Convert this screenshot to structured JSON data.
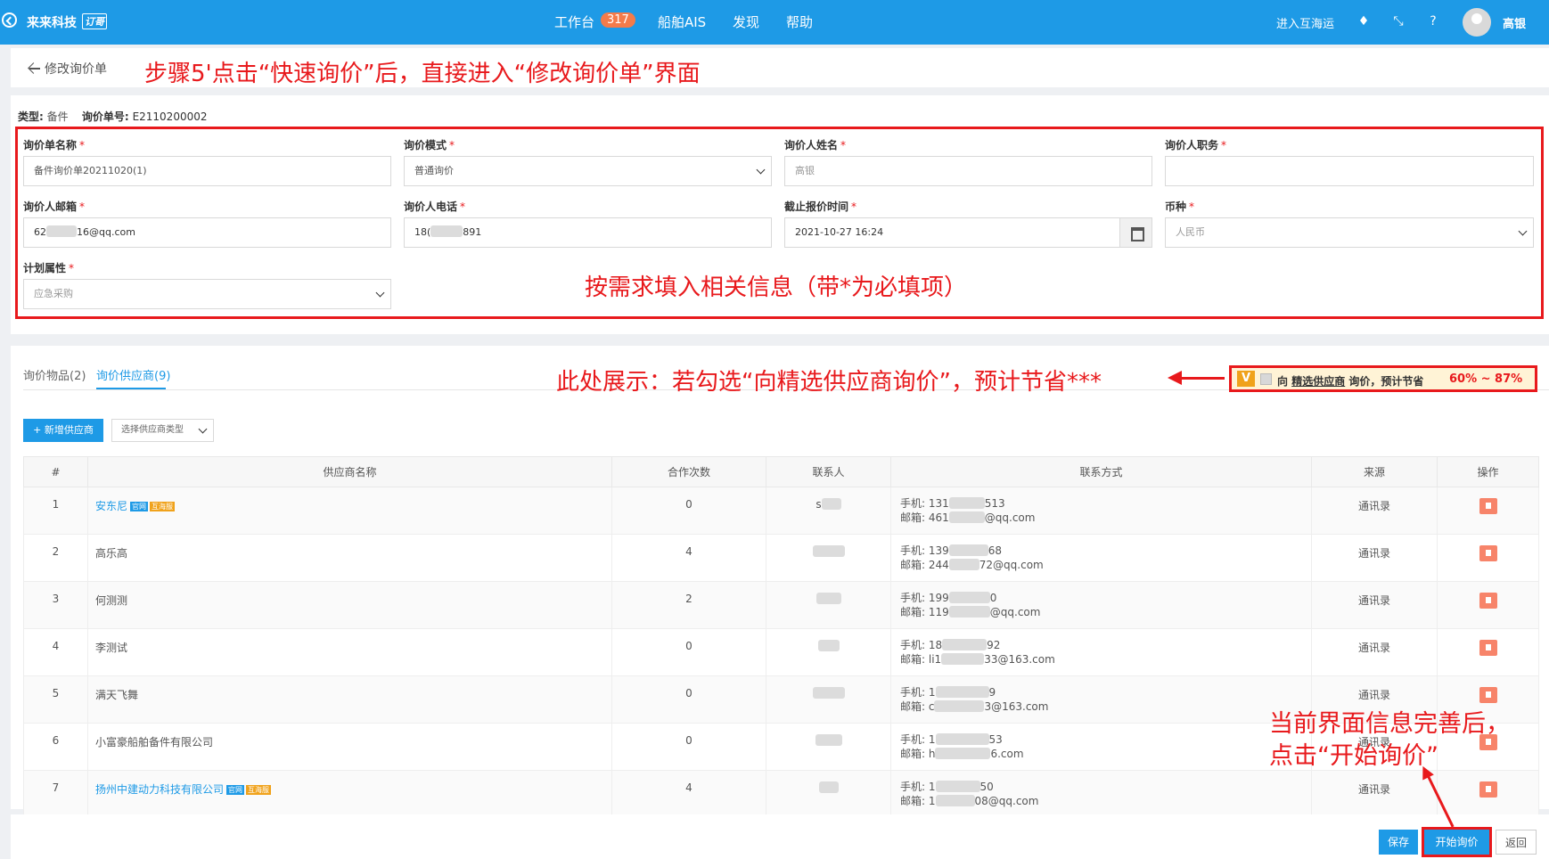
{
  "topbar": {
    "brand": "来来科技",
    "brand_badge": "订哥",
    "nav": [
      {
        "label": "工作台"
      },
      {
        "label": "船舶AIS"
      },
      {
        "label": "发现"
      },
      {
        "label": "帮助"
      }
    ],
    "workbench_count": "317",
    "enter_link": "进入互海运",
    "user_name": "高银",
    "colors": {
      "primary": "#1e9ae6",
      "badge": "#f37b4a",
      "annotation": "#e8191c"
    }
  },
  "header": {
    "back_label": "修改询价单",
    "annotation": "步骤5'点击“快速询价”后，直接进入“修改询价单”界面"
  },
  "meta": {
    "type_label": "类型:",
    "type_value": "备件",
    "no_label": "询价单号:",
    "no_value": "E2110200002"
  },
  "form": {
    "fields": [
      {
        "label": "询价单名称",
        "value": "备件询价单20211020(1)"
      },
      {
        "label": "询价模式",
        "value": "普通询价"
      },
      {
        "label": "询价人姓名",
        "value": "高银"
      },
      {
        "label": "询价人职务",
        "value": ""
      },
      {
        "label": "询价人邮箱",
        "value_prefix": "62",
        "value_suffix": "16@qq.com"
      },
      {
        "label": "询价人电话",
        "value_prefix": "18(",
        "value_suffix": "891"
      },
      {
        "label": "截止报价时间",
        "value": "2021-10-27 16:24"
      },
      {
        "label": "币种",
        "value": "人民币"
      },
      {
        "label": "计划属性",
        "value": "应急采购"
      }
    ],
    "required_mark": "*",
    "annotation": "按需求填入相关信息（带*为必填项）"
  },
  "tabs": [
    {
      "label": "询价物品(2)"
    },
    {
      "label": "询价供应商(9)"
    }
  ],
  "promo": {
    "annotation": "此处展示：若勾选“向精选供应商询价”，预计节省***",
    "v": "V",
    "text_prefix": "向",
    "text_link": "精选供应商",
    "text_suffix": "询价，预计节省",
    "percent": "60% ~ 87%"
  },
  "toolbar": {
    "add_supplier": "新增供应商",
    "supplier_type_placeholder": "选择供应商类型"
  },
  "table": {
    "headers": [
      "#",
      "供应商名称",
      "合作次数",
      "联系人",
      "联系方式",
      "来源",
      "操作"
    ],
    "phone_label": "手机:",
    "email_label": "邮箱:",
    "badge_g": "官网",
    "badge_v": "互海服",
    "rows": [
      {
        "no": "1",
        "name": "安东尼",
        "count": "0",
        "contact": "s",
        "phone_a": "131",
        "phone_b": "513",
        "email_a": "461",
        "email_b": "@qq.com",
        "source": "通讯录"
      },
      {
        "no": "2",
        "name": "高乐高",
        "count": "4",
        "contact": "",
        "phone_a": "139",
        "phone_b": "68",
        "email_a": "244",
        "email_b": "72@qq.com",
        "source": "通讯录"
      },
      {
        "no": "3",
        "name": "何测测",
        "count": "2",
        "contact": "",
        "phone_a": "199",
        "phone_b": "0",
        "email_a": "119",
        "email_b": "@qq.com",
        "source": "通讯录"
      },
      {
        "no": "4",
        "name": "李测试",
        "count": "0",
        "contact": "",
        "phone_a": "18",
        "phone_b": "92",
        "email_a": "li1",
        "email_b": "33@163.com",
        "source": "通讯录"
      },
      {
        "no": "5",
        "name": "满天飞舞",
        "count": "0",
        "contact": "",
        "phone_a": "1",
        "phone_b": "9",
        "email_a": "c",
        "email_b": "3@163.com",
        "source": "通讯录"
      },
      {
        "no": "6",
        "name": "小富豪船舶备件有限公司",
        "count": "0",
        "contact": "",
        "phone_a": "1",
        "phone_b": "53",
        "email_a": "h",
        "email_b": "6.com",
        "source": "通讯录"
      },
      {
        "no": "7",
        "name": "扬州中建动力科技有限公司",
        "count": "4",
        "contact": "",
        "phone_a": "1",
        "phone_b": "50",
        "email_a": "1",
        "email_b": "08@qq.com",
        "source": "通讯录"
      }
    ]
  },
  "footer": {
    "save": "保存",
    "start": "开始询价",
    "back": "返回",
    "annotation_line1": "当前界面信息完善后，",
    "annotation_line2": "点击“开始询价”"
  }
}
